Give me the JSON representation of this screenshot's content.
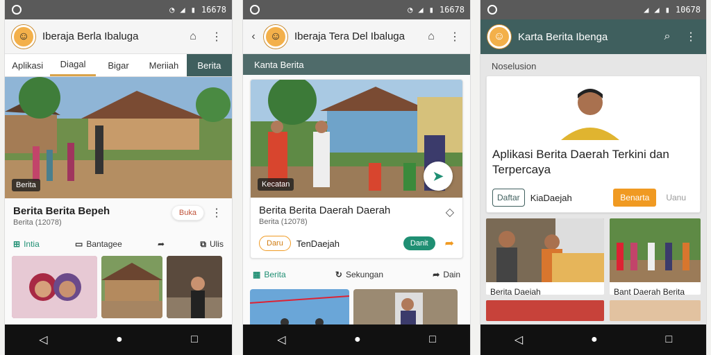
{
  "status": {
    "time": "16678",
    "time2": "16678",
    "time3": "10678"
  },
  "colors": {
    "accent": "#3f5f5e",
    "orange": "#f09a22",
    "green": "#1f8f73"
  },
  "phone1": {
    "title": "Iberaja Berla Ibaluga",
    "tabs": [
      "Aplikasi",
      "Diagal",
      "Bigar",
      "Meriiah",
      "Berita"
    ],
    "badge": "Berita",
    "headline": "Berita Berita Bepeh",
    "meta": "Berita (12078)",
    "action_chip": "Buka",
    "actions": [
      "Intia",
      "Bantagee",
      "Ulis"
    ]
  },
  "phone2": {
    "title": "Iberaja Tera Del Ibaluga",
    "subbar": "Kanta Berita",
    "badge": "Kecatan",
    "headline": "Berita Berita Daerah Daerah",
    "meta": "Berita (12078)",
    "chip_left": "Daru",
    "chip_left_label": "TenDaejah",
    "chip_right": "Danit",
    "actions": [
      "Berita",
      "Sekungan",
      "Dain"
    ]
  },
  "phone3": {
    "title": "Karta Berita Ibenga",
    "section": "Noselusion",
    "headline": "Aplikasi Berita Daerah Terkini dan Terpercaya",
    "outline_button": "Daftar",
    "outline_label": "KiaDaejah",
    "primary_button": "Benarta",
    "secondary_link": "Uanu",
    "thumb1": "Berita Daejah",
    "thumb2": "Bant Daerah Berita"
  }
}
